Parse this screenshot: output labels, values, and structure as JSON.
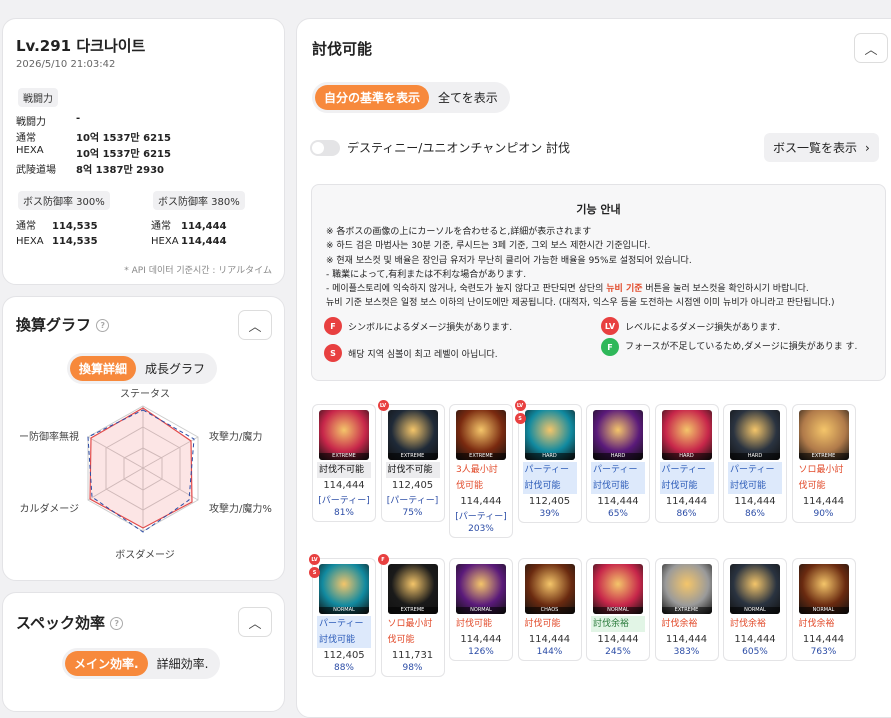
{
  "profile": {
    "title": "Lv.291 다크나이트",
    "datetime": "2026/5/10 21:03:42",
    "section_label": "戦闘力",
    "rows": [
      {
        "label": "戦闘力",
        "value": "-"
      },
      {
        "label": "通常",
        "value": "10억 1537만 6215"
      },
      {
        "label": "HEXA",
        "value": "10억 1537만 6215"
      },
      {
        "label": "武陵道場",
        "value": "8억 1387만 2930"
      }
    ],
    "def1": {
      "label": "ボス防御率 300%",
      "normal_label": "通常",
      "normal": "114,535",
      "hexa_label": "HEXA",
      "hexa": "114,535"
    },
    "def2": {
      "label": "ボス防御率 380%",
      "normal_label": "通常",
      "normal": "114,444",
      "hexa_label": "HEXA",
      "hexa": "114,444"
    },
    "footnote": "* API 데이터 기준시간 : リアルタイム"
  },
  "graph": {
    "title": "換算グラフ",
    "tab1": "換算詳細",
    "tab2": "成長グラフ",
    "axes": {
      "top": "ステータス",
      "tr": "攻撃力/魔力",
      "br": "攻撃力/魔力%",
      "bottom": "ボスダメージ",
      "bl": "カルダメージ",
      "tl": "ー防御率無視"
    }
  },
  "spec": {
    "title": "スペック効率",
    "tab1": "メイン効率.",
    "tab2": "詳細効率."
  },
  "main": {
    "title": "討伐可能",
    "filter_mine": "自分の基準を表示",
    "filter_all": "全てを表示",
    "toggle_label": "デスティニー/ユニオンチャンピオン 討伐",
    "boss_list_button": "ボス一覧を表示",
    "info": {
      "title": "기능 안내",
      "lines": [
        "※ 各ボスの画像の上にカーソルを合わせると,詳細が表示されます",
        "※ 하드 검은 마법사는 30분 기준, 루시드는 3페 기준, 그외 보스 제한시간 기준입니다.",
        "※ 현재 보스컷 및 배율은 장인급 유저가 무난히 클리어 가능한 배율을 95%로 설정되어 있습니다.",
        "- 職業によって,有利または不利な場合があります.",
        "- 메이플스토리에 익숙하지 않거나, 숙련도가 높지 않다고 판단되면 상단의 ",
        "뉴비 기준",
        " 버튼을 눌러 보스컷을 확인하시기 바랍니다.",
        "뉴비 기준 보스컷은 일정 보스 이하의 난이도에만 제공됩니다. (대적자, 익스우 등을 도전하는 시점엔 이미 뉴비가 아니라고 판단됩니다.)"
      ],
      "legend": [
        {
          "badge": "F",
          "color": "#e84040",
          "text": "シンボルによるダメージ損失があります."
        },
        {
          "badge": "LV",
          "color": "#e84040",
          "text": "レベルによるダメージ損失があります."
        },
        {
          "badge": "S",
          "color": "#e84040",
          "text": "해당 지역 심볼이 최고 레벨이 아닙니다."
        },
        {
          "badge": "F",
          "color": "#2fb85a",
          "text": "フォースが不足しているため,ダメージに損失がありま す."
        }
      ]
    },
    "bosses": [
      {
        "diff": "EXTREME",
        "status": "討伐不可能",
        "s2": "",
        "st": "gray",
        "num": "114,444",
        "sub": "[パーティー]",
        "pct": "81%",
        "img": "#c7264a",
        "marks": []
      },
      {
        "diff": "EXTREME",
        "status": "討伐不可能",
        "s2": "",
        "st": "gray",
        "num": "112,405",
        "sub": "[パーティー]",
        "pct": "75%",
        "img": "#1f2a38",
        "marks": [
          "LV"
        ]
      },
      {
        "diff": "EXTREME",
        "status": "3人最小討",
        "s2": "伐可能",
        "st": "red",
        "num": "114,444",
        "sub": "[パーティー]",
        "pct": "203%",
        "img": "#7a2a10",
        "marks": []
      },
      {
        "diff": "HARD",
        "status": "パーティー",
        "s2": "討伐可能",
        "st": "blue",
        "num": "112,405",
        "sub": "",
        "pct": "39%",
        "img": "#118aa0",
        "marks": [
          "LV",
          "S"
        ]
      },
      {
        "diff": "HARD",
        "status": "パーティー",
        "s2": "討伐可能",
        "st": "blue",
        "num": "114,444",
        "sub": "",
        "pct": "65%",
        "img": "#5a1a7a",
        "marks": []
      },
      {
        "diff": "HARD",
        "status": "パーティー",
        "s2": "討伐可能",
        "st": "blue",
        "num": "114,444",
        "sub": "",
        "pct": "86%",
        "img": "#c7264a",
        "marks": []
      },
      {
        "diff": "HARD",
        "status": "パーティー",
        "s2": "討伐可能",
        "st": "blue",
        "num": "114,444",
        "sub": "",
        "pct": "86%",
        "img": "#2a3340",
        "marks": []
      },
      {
        "diff": "EXTREME",
        "status": "ソロ最小討",
        "s2": "伐可能",
        "st": "red",
        "num": "114,444",
        "sub": "",
        "pct": "90%",
        "img": "#b07a4a",
        "marks": []
      },
      {
        "diff": "NORMAL",
        "status": "パーティー",
        "s2": "討伐可能",
        "st": "blue",
        "num": "112,405",
        "sub": "",
        "pct": "88%",
        "img": "#118aa0",
        "marks": [
          "LV",
          "S"
        ]
      },
      {
        "diff": "EXTREME",
        "status": "ソロ最小討",
        "s2": "伐可能",
        "st": "red",
        "num": "111,731",
        "sub": "",
        "pct": "98%",
        "img": "#1a1a1a",
        "marks": [
          "F"
        ]
      },
      {
        "diff": "NORMAL",
        "status": "討伐可能",
        "s2": "",
        "st": "red",
        "num": "114,444",
        "sub": "",
        "pct": "126%",
        "img": "#5a1a7a",
        "marks": []
      },
      {
        "diff": "CHAOS",
        "status": "討伐可能",
        "s2": "",
        "st": "red",
        "num": "114,444",
        "sub": "",
        "pct": "144%",
        "img": "#6a2a10",
        "marks": []
      },
      {
        "diff": "NORMAL",
        "status": "討伐余裕",
        "s2": "",
        "st": "grn",
        "num": "114,444",
        "sub": "",
        "pct": "245%",
        "img": "#c7264a",
        "marks": []
      },
      {
        "diff": "EXTREME",
        "status": "討伐余裕",
        "s2": "",
        "st": "red",
        "num": "114,444",
        "sub": "",
        "pct": "383%",
        "img": "#9a9a9a",
        "marks": []
      },
      {
        "diff": "NORMAL",
        "status": "討伐余裕",
        "s2": "",
        "st": "red",
        "num": "114,444",
        "sub": "",
        "pct": "605%",
        "img": "#2a3340",
        "marks": []
      },
      {
        "diff": "NORMAL",
        "status": "討伐余裕",
        "s2": "",
        "st": "red",
        "num": "114,444",
        "sub": "",
        "pct": "763%",
        "img": "#6a2a10",
        "marks": []
      }
    ]
  }
}
